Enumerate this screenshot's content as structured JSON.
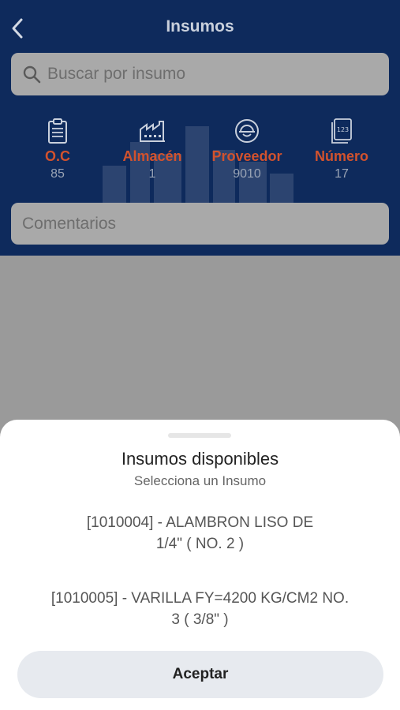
{
  "header": {
    "title": "Insumos",
    "back_icon": "chevron-left-icon"
  },
  "search": {
    "placeholder": "Buscar por insumo",
    "icon": "search-icon"
  },
  "stats": [
    {
      "label": "O.C",
      "value": "85",
      "icon": "clipboard-icon"
    },
    {
      "label": "Almacén",
      "value": "1",
      "icon": "warehouse-icon"
    },
    {
      "label": "Proveedor",
      "value": "9010",
      "icon": "worker-helmet-icon"
    },
    {
      "label": "Número",
      "value": "17",
      "icon": "number-document-icon"
    }
  ],
  "comments": {
    "placeholder": "Comentarios"
  },
  "sheet": {
    "title": "Insumos disponibles",
    "subtitle": "Selecciona un Insumo",
    "options": [
      {
        "line1": "[1010004] - ALAMBRON LISO DE",
        "line2": "1/4\" ( NO. 2 )"
      },
      {
        "line1": "[1010005] - VARILLA FY=4200 KG/CM2 NO.",
        "line2": "3 ( 3/8\" )"
      }
    ],
    "accept_label": "Aceptar"
  },
  "colors": {
    "header_bg": "#0e2a5c",
    "accent": "#d2522d",
    "overlay": "#9a9a9a"
  }
}
